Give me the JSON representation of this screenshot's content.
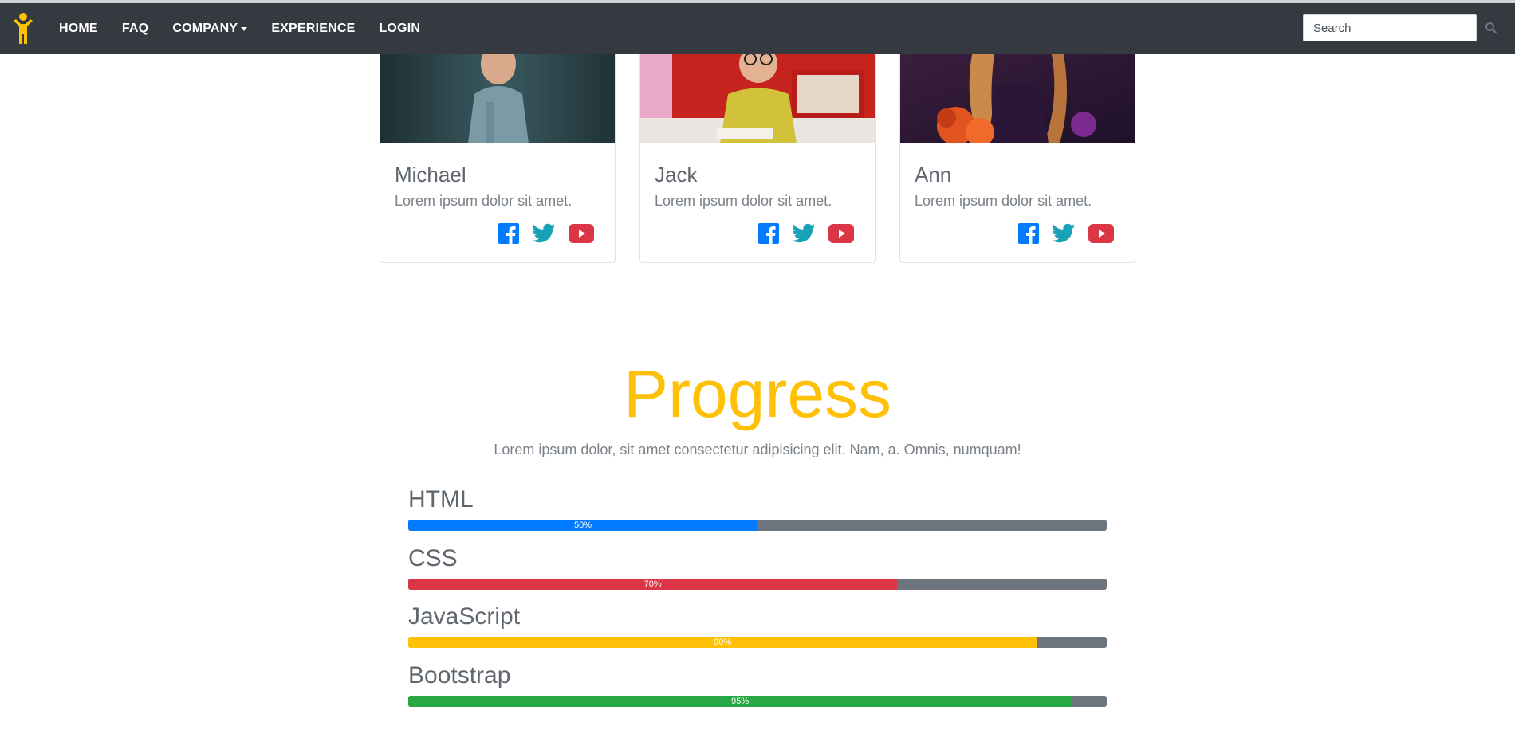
{
  "navbar": {
    "brand_icon": "person-icon",
    "links": [
      {
        "label": "HOME"
      },
      {
        "label": "FAQ"
      },
      {
        "label": "COMPANY"
      },
      {
        "label": "EXPERIENCE"
      },
      {
        "label": "LOGIN"
      }
    ],
    "search": {
      "placeholder": "Search",
      "value": ""
    },
    "search_icon": "search-icon"
  },
  "cards": [
    {
      "name": "Michael",
      "text": "Lorem ipsum dolor sit amet.",
      "icons": [
        "facebook-icon",
        "twitter-icon",
        "youtube-icon"
      ]
    },
    {
      "name": "Jack",
      "text": "Lorem ipsum dolor sit amet.",
      "icons": [
        "facebook-icon",
        "twitter-icon",
        "youtube-icon"
      ]
    },
    {
      "name": "Ann",
      "text": "Lorem ipsum dolor sit amet.",
      "icons": [
        "facebook-icon",
        "twitter-icon",
        "youtube-icon"
      ]
    }
  ],
  "progress_section": {
    "title": "Progress",
    "subtitle": "Lorem ipsum dolor, sit amet consectetur adipisicing elit. Nam, a. Omnis, numquam!",
    "skills": [
      {
        "name": "HTML",
        "percent_label": "50%",
        "value": 50,
        "color": "#007bff"
      },
      {
        "name": "CSS",
        "percent_label": "70%",
        "value": 70,
        "color": "#dc3545"
      },
      {
        "name": "JavaScript",
        "percent_label": "90%",
        "value": 90,
        "color": "#ffc107"
      },
      {
        "name": "Bootstrap",
        "percent_label": "95%",
        "value": 95,
        "color": "#28a745"
      }
    ]
  },
  "colors": {
    "navbar_bg": "#343a40",
    "accent": "#ffc107",
    "facebook": "#007bff",
    "twitter": "#17a2b8",
    "youtube": "#dc3545",
    "track": "#6c757d"
  }
}
